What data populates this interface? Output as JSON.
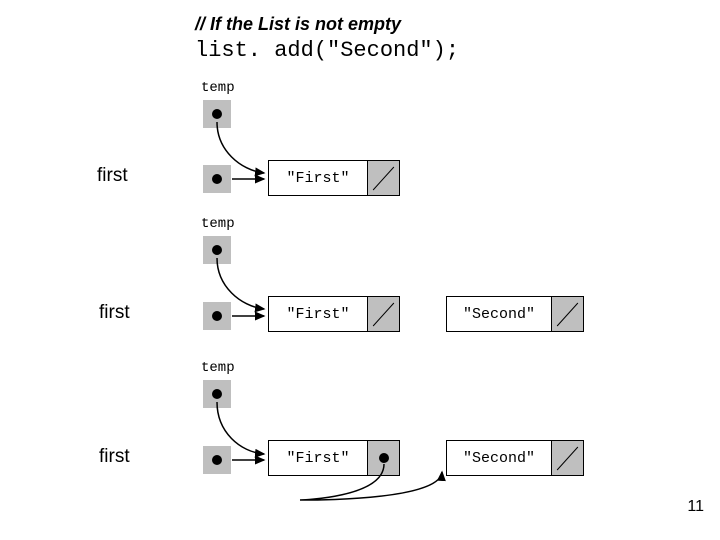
{
  "title": "// If the List is not empty",
  "code_line": "list. add(\"Second\");",
  "page_number": "11",
  "labels": {
    "temp": "temp",
    "first": "first"
  },
  "node_values": {
    "first": "\"First\"",
    "second": "\"Second\""
  },
  "steps": [
    {
      "description": "temp points to same node as first; single node 'First' with null next",
      "first_label": "first",
      "temp_label": "temp",
      "nodes": [
        {
          "value_key": "first",
          "next": "null"
        }
      ]
    },
    {
      "description": "temp still at first node; new 'Second' node allocated with null next",
      "first_label": "first",
      "temp_label": "temp",
      "nodes": [
        {
          "value_key": "first",
          "next": "null"
        },
        {
          "value_key": "second",
          "next": "null"
        }
      ]
    },
    {
      "description": "first node's next set to 'Second'; list now has two nodes",
      "first_label": "first",
      "temp_label": "temp",
      "nodes": [
        {
          "value_key": "first",
          "next": "node2"
        },
        {
          "value_key": "second",
          "next": "null"
        }
      ]
    }
  ]
}
